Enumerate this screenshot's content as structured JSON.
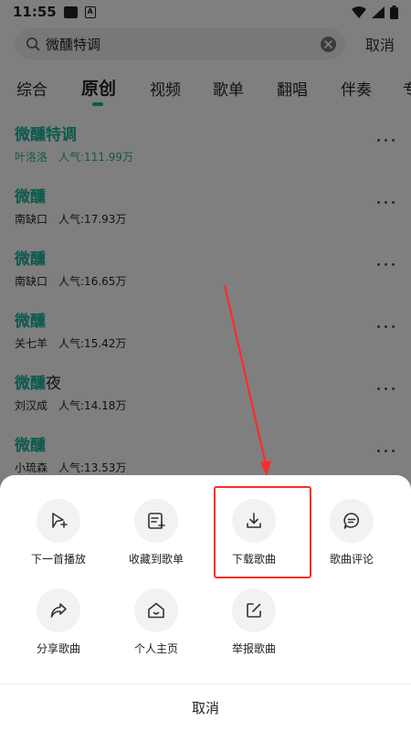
{
  "status": {
    "time": "11:55"
  },
  "search": {
    "query": "微醺特调",
    "cancel_label": "取消"
  },
  "tabs": [
    {
      "label": "综合",
      "active": false
    },
    {
      "label": "原创",
      "active": true
    },
    {
      "label": "视频",
      "active": false
    },
    {
      "label": "歌单",
      "active": false
    },
    {
      "label": "翻唱",
      "active": false
    },
    {
      "label": "伴奏",
      "active": false
    },
    {
      "label": "专",
      "active": false
    }
  ],
  "songs": [
    {
      "title_hl": "微醺特调",
      "title_rest": "",
      "artist": "叶洛洛",
      "popularity": "人气:111.99万",
      "highlighted": true
    },
    {
      "title_hl": "微醺",
      "title_rest": "",
      "artist": "南缺口",
      "popularity": "人气:17.93万",
      "highlighted": false
    },
    {
      "title_hl": "微醺",
      "title_rest": "",
      "artist": "南缺口",
      "popularity": "人气:16.65万",
      "highlighted": false
    },
    {
      "title_hl": "微醺",
      "title_rest": "",
      "artist": "关七羊",
      "popularity": "人气:15.42万",
      "highlighted": false
    },
    {
      "title_hl": "微醺",
      "title_rest": "夜",
      "artist": "刘汉成",
      "popularity": "人气:14.18万",
      "highlighted": false
    },
    {
      "title_hl": "微醺",
      "title_rest": "",
      "artist": "小琉森",
      "popularity": "人气:13.53万",
      "highlighted": false
    }
  ],
  "sheet": {
    "actions": [
      {
        "label": "下一首播放",
        "icon": "play-next-icon"
      },
      {
        "label": "收藏到歌单",
        "icon": "add-to-playlist-icon"
      },
      {
        "label": "下载歌曲",
        "icon": "download-icon"
      },
      {
        "label": "歌曲评论",
        "icon": "comment-icon"
      },
      {
        "label": "分享歌曲",
        "icon": "share-icon"
      },
      {
        "label": "个人主页",
        "icon": "home-icon"
      },
      {
        "label": "举报歌曲",
        "icon": "report-icon"
      }
    ],
    "cancel_label": "取消"
  },
  "colors": {
    "accent": "#1fb39b",
    "annotation": "#ff2b2b"
  }
}
